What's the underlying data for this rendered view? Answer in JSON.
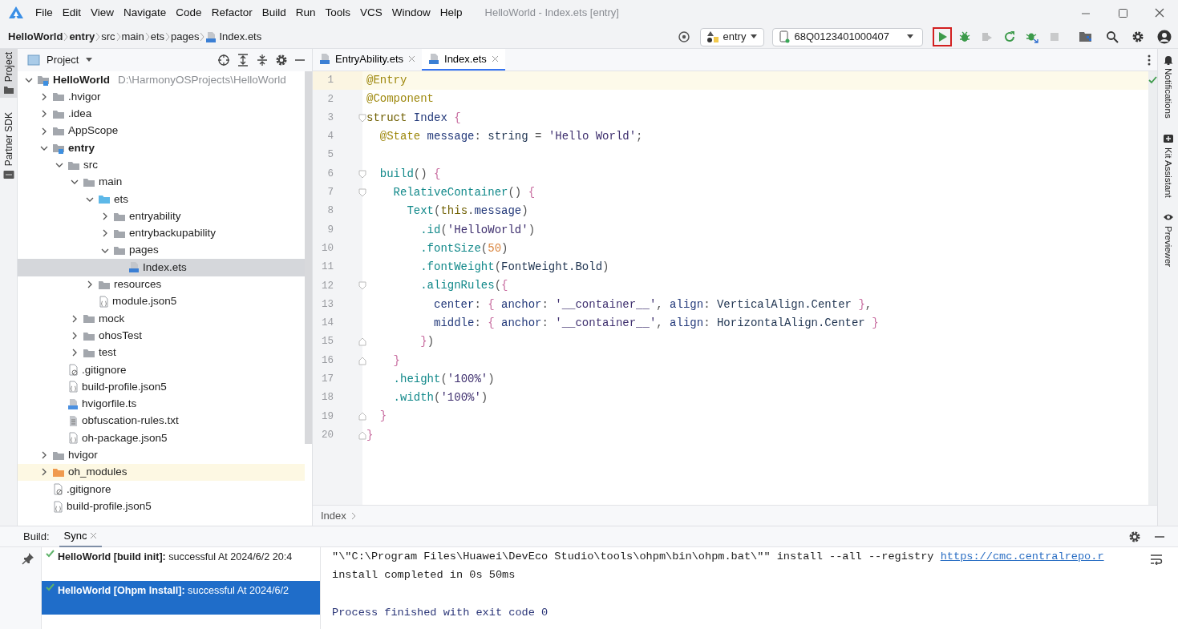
{
  "window": {
    "title": "HelloWorld - Index.ets [entry]"
  },
  "menu": [
    "File",
    "Edit",
    "View",
    "Navigate",
    "Code",
    "Refactor",
    "Build",
    "Run",
    "Tools",
    "VCS",
    "Window",
    "Help"
  ],
  "breadcrumbs": [
    {
      "label": "HelloWorld",
      "kind": "module"
    },
    {
      "label": "entry",
      "kind": "module"
    },
    {
      "label": "src",
      "kind": "folder"
    },
    {
      "label": "main",
      "kind": "folder"
    },
    {
      "label": "ets",
      "kind": "folder"
    },
    {
      "label": "pages",
      "kind": "folder"
    },
    {
      "label": "Index.ets",
      "kind": "ets"
    }
  ],
  "run_config": {
    "label": "entry"
  },
  "device": {
    "label": "68Q0123401000407"
  },
  "toolbar": [
    {
      "kind": "run",
      "highlighted": true,
      "disabled": false
    },
    {
      "kind": "debug",
      "highlighted": false,
      "disabled": false
    },
    {
      "kind": "attach",
      "highlighted": false,
      "disabled": true
    },
    {
      "kind": "reload",
      "highlighted": false,
      "disabled": false
    },
    {
      "kind": "profile",
      "highlighted": false,
      "disabled": false
    },
    {
      "kind": "stop",
      "highlighted": false,
      "disabled": true
    }
  ],
  "left_strip": [
    {
      "label": "Project",
      "kind": "project",
      "selected": true
    },
    {
      "label": "Partner SDK",
      "kind": "sdk",
      "selected": false
    }
  ],
  "project_panel": {
    "title": "Project",
    "tree": [
      {
        "label": "HelloWorld",
        "kind": "module",
        "hint": "D:\\HarmonyOSProjects\\HelloWorld",
        "expanded": true,
        "selected": false,
        "children": [
          {
            "label": ".hvigor",
            "kind": "folder",
            "expanded": false,
            "selected": false
          },
          {
            "label": ".idea",
            "kind": "folder",
            "expanded": false,
            "selected": false
          },
          {
            "label": "AppScope",
            "kind": "folder",
            "expanded": false,
            "selected": false
          },
          {
            "label": "entry",
            "kind": "module",
            "expanded": true,
            "selected": false,
            "children": [
              {
                "label": "src",
                "kind": "folder",
                "expanded": true,
                "selected": false,
                "children": [
                  {
                    "label": "main",
                    "kind": "folder",
                    "expanded": true,
                    "selected": false,
                    "children": [
                      {
                        "label": "ets",
                        "kind": "source",
                        "expanded": true,
                        "selected": false,
                        "children": [
                          {
                            "label": "entryability",
                            "kind": "folder",
                            "expanded": false,
                            "selected": false
                          },
                          {
                            "label": "entrybackupability",
                            "kind": "folder",
                            "expanded": false,
                            "selected": false
                          },
                          {
                            "label": "pages",
                            "kind": "folder",
                            "expanded": true,
                            "selected": false,
                            "children": [
                              {
                                "label": "Index.ets",
                                "kind": "ets",
                                "selected": true
                              }
                            ]
                          }
                        ]
                      },
                      {
                        "label": "resources",
                        "kind": "folder",
                        "expanded": false,
                        "selected": false
                      },
                      {
                        "label": "module.json5",
                        "kind": "json",
                        "selected": false
                      }
                    ]
                  },
                  {
                    "label": "mock",
                    "kind": "folder",
                    "expanded": false,
                    "selected": false
                  },
                  {
                    "label": "ohosTest",
                    "kind": "folder",
                    "expanded": false,
                    "selected": false
                  },
                  {
                    "label": "test",
                    "kind": "folder",
                    "expanded": false,
                    "selected": false
                  }
                ]
              },
              {
                "label": ".gitignore",
                "kind": "ignore",
                "selected": false
              },
              {
                "label": "build-profile.json5",
                "kind": "json",
                "selected": false
              },
              {
                "label": "hvigorfile.ts",
                "kind": "ts",
                "selected": false
              },
              {
                "label": "obfuscation-rules.txt",
                "kind": "text",
                "selected": false
              },
              {
                "label": "oh-package.json5",
                "kind": "json",
                "selected": false
              }
            ]
          },
          {
            "label": "hvigor",
            "kind": "folder",
            "expanded": false,
            "selected": false
          },
          {
            "label": "oh_modules",
            "kind": "excluded",
            "expanded": false,
            "selected": false
          },
          {
            "label": ".gitignore",
            "kind": "ignore",
            "selected": false
          },
          {
            "label": "build-profile.json5",
            "kind": "json",
            "selected": false
          }
        ]
      }
    ]
  },
  "editor_tabs": [
    {
      "label": "EntryAbility.ets",
      "selected": false
    },
    {
      "label": "Index.ets",
      "selected": true
    }
  ],
  "code": [
    {
      "number": "1",
      "current": true,
      "tokens": [
        {
          "kind": "annotation",
          "text": "@Entry"
        }
      ]
    },
    {
      "number": "2",
      "current": false,
      "tokens": [
        {
          "kind": "annotation",
          "text": "@Component"
        }
      ]
    },
    {
      "number": "3",
      "current": false,
      "fold_start": true,
      "tokens": [
        {
          "kind": "keyword",
          "text": "struct"
        },
        {
          "kind": "ident",
          "text": " Index "
        },
        {
          "kind": "brace",
          "text": "{"
        }
      ]
    },
    {
      "number": "4",
      "current": false,
      "tokens": [
        {
          "kind": "annotation",
          "text": "  @State"
        },
        {
          "kind": "ident",
          "text": " message"
        },
        {
          "kind": "punct",
          "text": ": "
        },
        {
          "kind": "type",
          "text": "string"
        },
        {
          "kind": "punct",
          "text": " = "
        },
        {
          "kind": "string",
          "text": "'Hello World'"
        },
        {
          "kind": "punct",
          "text": ";"
        }
      ]
    },
    {
      "number": "5",
      "current": false
    },
    {
      "number": "6",
      "current": false,
      "fold_start": true,
      "tokens": [
        {
          "kind": "func",
          "text": "  build"
        },
        {
          "kind": "punct",
          "text": "() "
        },
        {
          "kind": "brace",
          "text": "{"
        }
      ]
    },
    {
      "number": "7",
      "current": false,
      "fold_start": true,
      "tokens": [
        {
          "kind": "func",
          "text": "    RelativeContainer"
        },
        {
          "kind": "punct",
          "text": "() "
        },
        {
          "kind": "brace",
          "text": "{"
        }
      ]
    },
    {
      "number": "8",
      "current": false,
      "tokens": [
        {
          "kind": "func",
          "text": "      Text"
        },
        {
          "kind": "punct",
          "text": "("
        },
        {
          "kind": "keyword",
          "text": "this"
        },
        {
          "kind": "punct",
          "text": "."
        },
        {
          "kind": "ident",
          "text": "message"
        },
        {
          "kind": "punct",
          "text": ")"
        }
      ]
    },
    {
      "number": "9",
      "current": false,
      "tokens": [
        {
          "kind": "func",
          "text": "        .id"
        },
        {
          "kind": "punct",
          "text": "("
        },
        {
          "kind": "string",
          "text": "'HelloWorld'"
        },
        {
          "kind": "punct",
          "text": ")"
        }
      ]
    },
    {
      "number": "10",
      "current": false,
      "tokens": [
        {
          "kind": "func",
          "text": "        .fontSize"
        },
        {
          "kind": "punct",
          "text": "("
        },
        {
          "kind": "number",
          "text": "50"
        },
        {
          "kind": "punct",
          "text": ")"
        }
      ]
    },
    {
      "number": "11",
      "current": false,
      "tokens": [
        {
          "kind": "func",
          "text": "        .fontWeight"
        },
        {
          "kind": "punct",
          "text": "("
        },
        {
          "kind": "type",
          "text": "FontWeight.Bold"
        },
        {
          "kind": "punct",
          "text": ")"
        }
      ]
    },
    {
      "number": "12",
      "current": false,
      "fold_start": true,
      "tokens": [
        {
          "kind": "func",
          "text": "        .alignRules"
        },
        {
          "kind": "punct",
          "text": "("
        },
        {
          "kind": "brace",
          "text": "{"
        }
      ]
    },
    {
      "number": "13",
      "current": false,
      "tokens": [
        {
          "kind": "ident",
          "text": "          center"
        },
        {
          "kind": "punct",
          "text": ": "
        },
        {
          "kind": "brace",
          "text": "{"
        },
        {
          "kind": "ident",
          "text": " anchor"
        },
        {
          "kind": "punct",
          "text": ": "
        },
        {
          "kind": "string",
          "text": "'__container__'"
        },
        {
          "kind": "punct",
          "text": ", "
        },
        {
          "kind": "ident",
          "text": "align"
        },
        {
          "kind": "punct",
          "text": ": "
        },
        {
          "kind": "type",
          "text": "VerticalAlign.Center "
        },
        {
          "kind": "brace",
          "text": "}"
        },
        {
          "kind": "punct",
          "text": ","
        }
      ]
    },
    {
      "number": "14",
      "current": false,
      "tokens": [
        {
          "kind": "ident",
          "text": "          middle"
        },
        {
          "kind": "punct",
          "text": ": "
        },
        {
          "kind": "brace",
          "text": "{"
        },
        {
          "kind": "ident",
          "text": " anchor"
        },
        {
          "kind": "punct",
          "text": ": "
        },
        {
          "kind": "string",
          "text": "'__container__'"
        },
        {
          "kind": "punct",
          "text": ", "
        },
        {
          "kind": "ident",
          "text": "align"
        },
        {
          "kind": "punct",
          "text": ": "
        },
        {
          "kind": "type",
          "text": "HorizontalAlign.Center "
        },
        {
          "kind": "brace",
          "text": "}"
        }
      ]
    },
    {
      "number": "15",
      "current": false,
      "fold_end": true,
      "tokens": [
        {
          "kind": "brace",
          "text": "        }"
        },
        {
          "kind": "punct",
          "text": ")"
        }
      ]
    },
    {
      "number": "16",
      "current": false,
      "fold_end": true,
      "tokens": [
        {
          "kind": "brace",
          "text": "    }"
        }
      ]
    },
    {
      "number": "17",
      "current": false,
      "tokens": [
        {
          "kind": "func",
          "text": "    .height"
        },
        {
          "kind": "punct",
          "text": "("
        },
        {
          "kind": "string",
          "text": "'100%'"
        },
        {
          "kind": "punct",
          "text": ")"
        }
      ]
    },
    {
      "number": "18",
      "current": false,
      "tokens": [
        {
          "kind": "func",
          "text": "    .width"
        },
        {
          "kind": "punct",
          "text": "("
        },
        {
          "kind": "string",
          "text": "'100%'"
        },
        {
          "kind": "punct",
          "text": ")"
        }
      ]
    },
    {
      "number": "19",
      "current": false,
      "fold_end": true,
      "tokens": [
        {
          "kind": "brace",
          "text": "  }"
        }
      ]
    },
    {
      "number": "20",
      "current": false,
      "fold_end": true,
      "tokens": [
        {
          "kind": "brace",
          "text": "}"
        }
      ]
    }
  ],
  "code_breadcrumb": "Index",
  "right_strip": [
    {
      "label": "Notifications",
      "kind": "bell"
    },
    {
      "label": "Kit Assistant",
      "kind": "kit"
    },
    {
      "label": "Previewer",
      "kind": "preview"
    }
  ],
  "build_panel": {
    "label": "Build:",
    "tabs": [
      {
        "label": "Sync",
        "selected": true
      }
    ],
    "tasks": [
      {
        "text": "**HelloWorld [build init]:** successful At 2024/6/2 20:4",
        "succeeded": true,
        "selected": false
      },
      {
        "text": "**HelloWorld [Ohpm Install]:** successful At 2024/6/2",
        "succeeded": true,
        "selected": true
      }
    ],
    "console": [
      {
        "kind": "output",
        "text": "\"\\\"C:\\Program Files\\Huawei\\DevEco Studio\\tools\\ohpm\\bin\\ohpm.bat\\\"\" install --all --registry ",
        "link": "https://cmc.centralrepo.r"
      },
      {
        "kind": "output",
        "text": "install completed in 0s 50ms"
      },
      {
        "kind": "gap"
      },
      {
        "kind": "system",
        "text": "Process finished with exit code 0"
      }
    ]
  }
}
